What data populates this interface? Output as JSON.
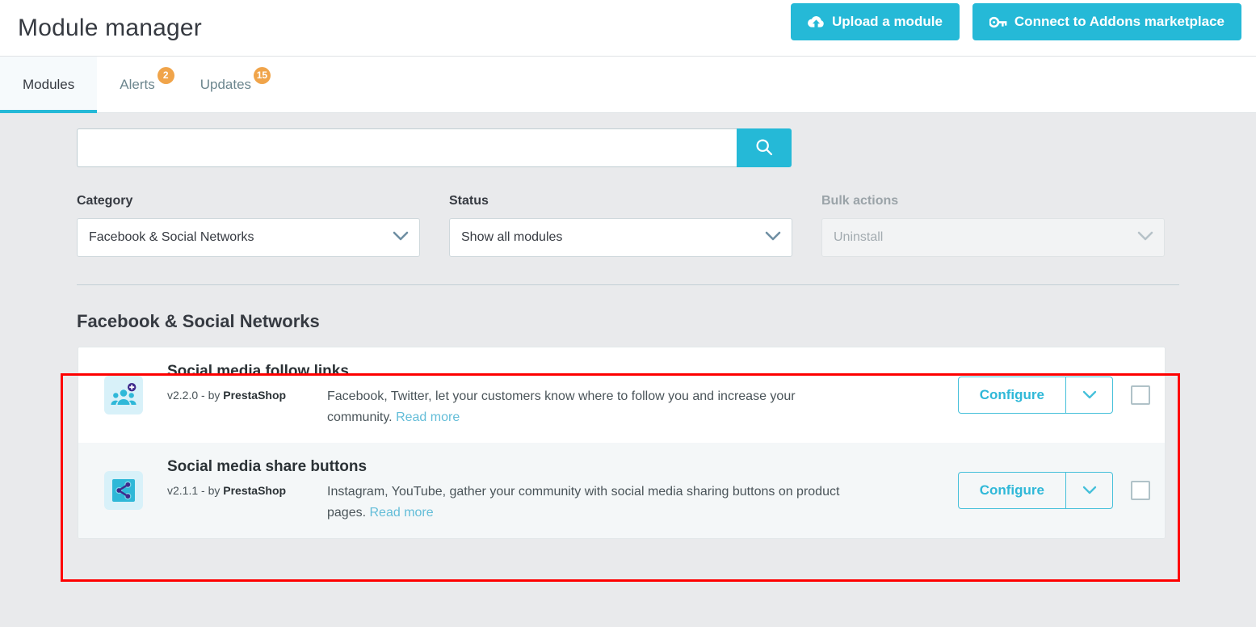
{
  "header": {
    "title": "Module manager",
    "buttons": [
      {
        "label": "Upload a module",
        "icon": "cloud-upload-icon"
      },
      {
        "label": "Connect to Addons marketplace",
        "icon": "key-icon"
      }
    ],
    "accent_color": "#25b9d7"
  },
  "tabs": [
    {
      "label": "Modules",
      "badge": "",
      "active": true
    },
    {
      "label": "Alerts",
      "badge": "2",
      "active": false
    },
    {
      "label": "Updates",
      "badge": "15",
      "active": false
    }
  ],
  "search": {
    "value": "",
    "placeholder": "",
    "button_icon": "search-icon"
  },
  "filters": [
    {
      "label": "Category",
      "value": "Facebook & Social Networks",
      "disabled": false
    },
    {
      "label": "Status",
      "value": "Show all modules",
      "disabled": false
    },
    {
      "label": "Bulk actions",
      "value": "Uninstall",
      "disabled": true
    }
  ],
  "section": {
    "title": "Facebook & Social Networks"
  },
  "modules": [
    {
      "name": "Social media follow links",
      "version": "v2.2.0",
      "by_prefix": "- by",
      "author": "PrestaShop",
      "description": "Facebook, Twitter, let your customers know where to follow you and increase your community.",
      "read_more": "Read more",
      "icon": "social-follow-icon",
      "configure_label": "Configure",
      "checked": false
    },
    {
      "name": "Social media share buttons",
      "version": "v2.1.1",
      "by_prefix": "- by",
      "author": "PrestaShop",
      "description": "Instagram, YouTube, gather your community with social media sharing buttons on product pages.",
      "read_more": "Read more",
      "icon": "social-share-icon",
      "configure_label": "Configure",
      "checked": false
    }
  ],
  "annotation": {
    "color": "#fe0000"
  }
}
